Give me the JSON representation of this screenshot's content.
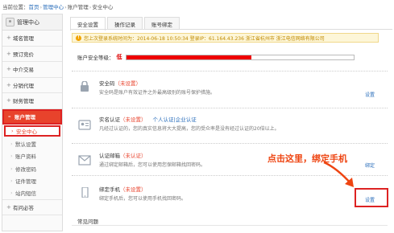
{
  "breadcrumb": {
    "prefix": "当前位置：",
    "items": [
      "首页",
      "管理中心",
      "账户管理",
      "安全中心"
    ]
  },
  "sidebar": {
    "header": "管理中心",
    "items": [
      {
        "label": "域名管理"
      },
      {
        "label": "预订竞价"
      },
      {
        "label": "中介交易"
      },
      {
        "label": "分销代理"
      },
      {
        "label": "财务管理"
      },
      {
        "label": "账户管理"
      }
    ],
    "subitems": [
      "安全中心",
      "默认设置",
      "账户资料",
      "修改密码",
      "证件管理",
      "站内短信"
    ],
    "footer": "有问必答"
  },
  "tabs": [
    "安全设置",
    "操作记录",
    "账号绑定"
  ],
  "notice": "您上次登录系统时间为：2014-06-18 10:50:34 登录IP：61.164.43.236 浙江省杭州市 浙江电信网络有限公司",
  "security_level": {
    "label": "账户安全等级：",
    "value": "低",
    "progress": 0.55
  },
  "rows": [
    {
      "title": "安全码",
      "status": "（未设置）",
      "desc": "安全码是账户有效证件之外最高级别的账号保护措施。",
      "link": "设置",
      "icon": "lock-icon"
    },
    {
      "title": "实名认证",
      "status": "（未设置）",
      "extra": "个人认证|企业认证",
      "desc": "凡经过认证的，您的真实信息将大大提高，您的受众率是没有经过认证的20倍以上。",
      "link": "设置",
      "icon": "id-card-icon"
    },
    {
      "title": "认证邮箱",
      "status": "（未认证）",
      "desc": "通过绑定邮箱后，您可以使用您保邮箱找回密码。",
      "link": "绑定",
      "icon": "envelope-icon"
    },
    {
      "title": "绑定手机",
      "status": "（未设置）",
      "desc": "绑定手机后，您可以使用手机找回密码。",
      "link": "设置",
      "icon": "phone-icon"
    }
  ],
  "callout": "点击这里，绑定手机",
  "faq": "常见问题",
  "colors": {
    "accent": "#e8432c",
    "link": "#2a6ebb",
    "notice_bg": "#fdf6d8"
  }
}
